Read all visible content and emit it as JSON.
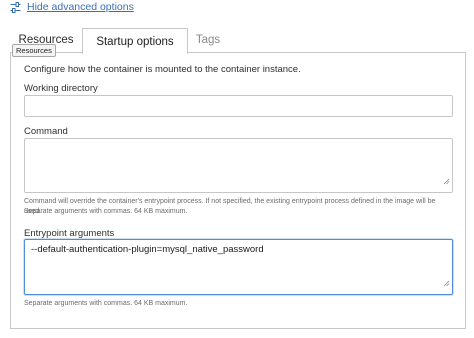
{
  "advanced": {
    "label": "Hide advanced options",
    "icon": "sliders-icon"
  },
  "tabs": [
    {
      "label": "Resources"
    },
    {
      "label": "Startup options"
    },
    {
      "label": "Tags"
    }
  ],
  "tooltip": "Resources",
  "panel": {
    "intro": "Configure how the container is mounted to the container instance.",
    "working_directory": {
      "label": "Working directory",
      "value": ""
    },
    "command": {
      "label": "Command",
      "value": "",
      "help_line1": "Command will override the container's entrypoint process. If not specified, the existing entrypoint process defined in the image will be used.",
      "help_line2": "Separate arguments with commas. 64 KB maximum."
    },
    "entrypoint": {
      "label": "Entrypoint arguments",
      "value": "--default-authentication-plugin=mysql_native_password",
      "help": "Separate arguments with commas. 64 KB maximum."
    }
  },
  "colors": {
    "link": "#3a6fb5",
    "focus": "#4f8fda",
    "border": "#c6c6c6"
  }
}
